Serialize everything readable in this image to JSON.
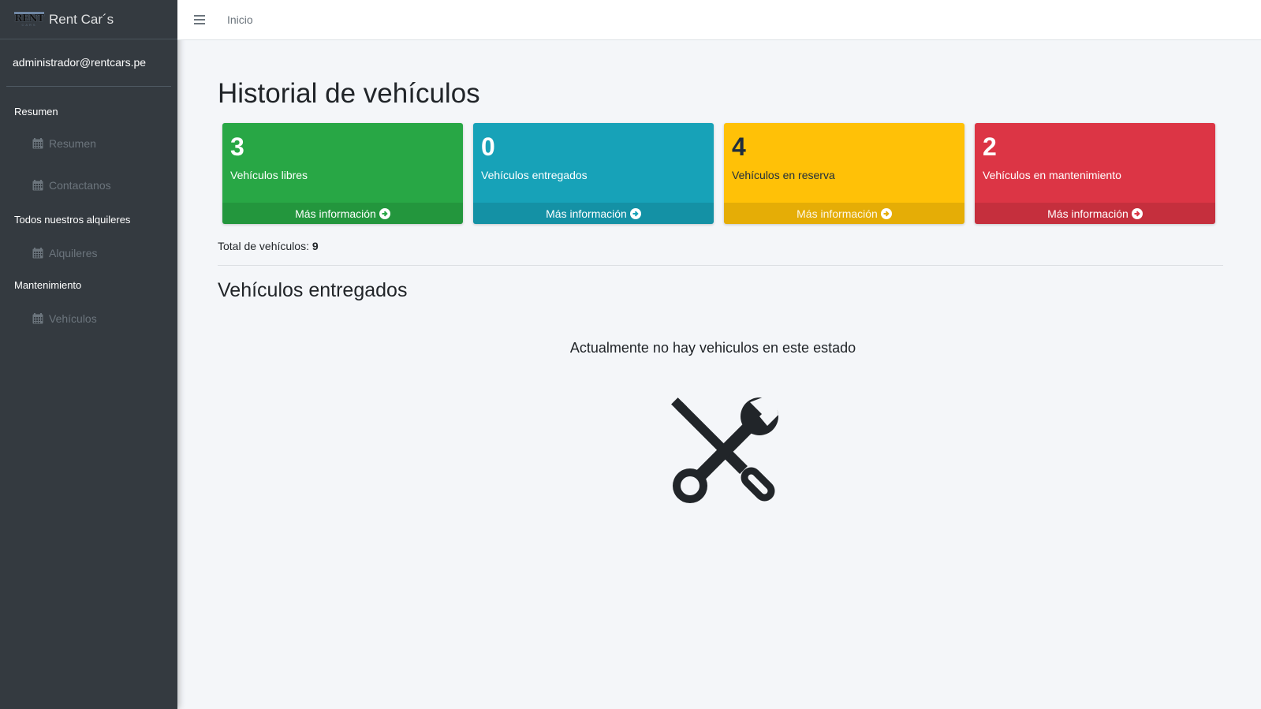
{
  "brand": {
    "logo_text": "RENT",
    "logo_sub": "CARS",
    "name": "Rent Car´s"
  },
  "user": {
    "email": "administrador@rentcars.pe"
  },
  "sidebar": {
    "sections": [
      {
        "header": "Resumen",
        "items": [
          {
            "label": "Resumen",
            "icon": "calendar-icon"
          },
          {
            "label": "Contactanos",
            "icon": "calendar-icon"
          }
        ]
      },
      {
        "header": "Todos nuestros alquileres",
        "items": [
          {
            "label": "Alquileres",
            "icon": "calendar-icon"
          }
        ]
      },
      {
        "header": "Mantenimiento",
        "items": [
          {
            "label": "Vehículos",
            "icon": "calendar-icon"
          }
        ]
      }
    ]
  },
  "topbar": {
    "menu_icon": "bars-icon",
    "home_link": "Inicio"
  },
  "main": {
    "title": "Historial de vehículos",
    "cards": [
      {
        "count": "3",
        "label": "Vehículos libres",
        "link": "Más información",
        "color": "#28a745"
      },
      {
        "count": "0",
        "label": "Vehículos entregados",
        "link": "Más información",
        "color": "#17a2b8"
      },
      {
        "count": "4",
        "label": "Vehículos en reserva",
        "link": "Más información",
        "color": "#ffc107"
      },
      {
        "count": "2",
        "label": "Vehículos en mantenimiento",
        "link": "Más información",
        "color": "#dc3545"
      }
    ],
    "total_label": "Total de vehículos:",
    "total_value": "9",
    "section_title": "Vehículos entregados",
    "empty_message": "Actualmente no hay vehiculos en este estado",
    "empty_icon": "tools-icon"
  }
}
